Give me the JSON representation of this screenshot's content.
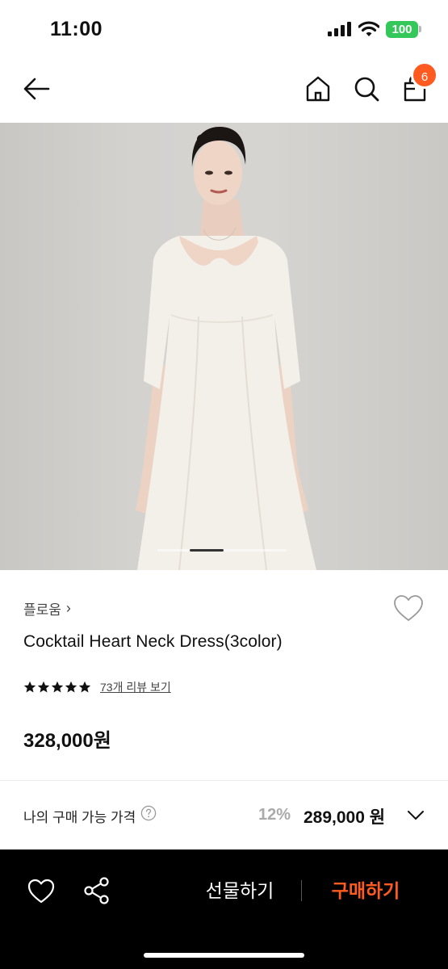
{
  "status_bar": {
    "time": "11:00",
    "battery": "100",
    "icons": [
      "signal-icon",
      "wifi-icon",
      "battery-icon"
    ]
  },
  "nav": {
    "icons": [
      "back-arrow-icon",
      "home-icon",
      "search-icon",
      "shopping-bag-icon"
    ],
    "cart_count": "6"
  },
  "product": {
    "image_pager": {
      "current": 1
    },
    "brand": "플로움",
    "brand_chevron": "›",
    "title": "Cocktail Heart Neck Dress(3color)",
    "rating": 5,
    "review_link": "73개 리뷰 보기",
    "price": "328,000원"
  },
  "my_price": {
    "label": "나의 구매 가능 가격",
    "discount": "12%",
    "price": "289,000 원"
  },
  "bottom_bar": {
    "gift_label": "선물하기",
    "buy_label": "구매하기"
  },
  "colors": {
    "accent": "#ff5a1f",
    "badge": "#ff5a1f",
    "battery": "#34c759",
    "bottom_bar": "#000000"
  }
}
